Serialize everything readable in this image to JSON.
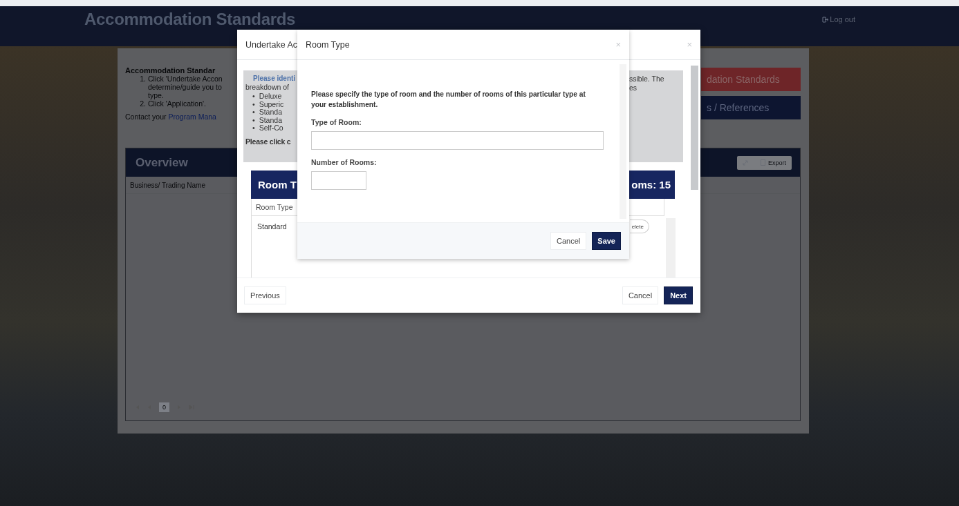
{
  "header": {
    "title": "Accommodation Standards",
    "logout": "Log out"
  },
  "page": {
    "intro_title": "Accommodation Standar",
    "steps": [
      {
        "number": "1.",
        "lines": [
          "Click 'Undertake Accon",
          "determine/guide you to",
          "type."
        ]
      },
      {
        "number": "2.",
        "lines": [
          "Click 'Application'."
        ]
      }
    ],
    "contact": {
      "text": "Contact your",
      "link": "Program Mana"
    },
    "side_buttons": [
      {
        "label": "dation Standards",
        "kind": "primary"
      },
      {
        "label": "s / References",
        "kind": "secondary"
      }
    ],
    "overview": {
      "title": "Overview",
      "export": "Export",
      "columns": [
        "Business/ Trading Name"
      ],
      "page": "0"
    }
  },
  "outer_modal": {
    "title": "Undertake Ac",
    "close": "×",
    "info": {
      "lead": "Please identi",
      "lead_right": "ssible. The",
      "line2": "breakdown of",
      "line2_right": "es",
      "bullets": [
        {
          "marker": "•",
          "text": "Deluxe"
        },
        {
          "marker": "•",
          "text": "Superic"
        },
        {
          "marker": "•",
          "text": "Standa"
        },
        {
          "marker": "•",
          "text": "Standa"
        },
        {
          "marker": "•",
          "text": "Self-Co"
        }
      ],
      "footer": "Please click c"
    },
    "room_table": {
      "title": "Room T",
      "total": "oms: 15",
      "columns": [
        "Room Type"
      ],
      "rows": [
        {
          "room_type": "Standard",
          "action": "elete"
        }
      ]
    },
    "buttons": {
      "previous": "Previous",
      "cancel": "Cancel",
      "next": "Next"
    }
  },
  "inner_modal": {
    "title": "Room Type",
    "close": "×",
    "instructions": "Please specify the type of room and the number of rooms of this particular type at your establishment.",
    "fields": [
      {
        "label": "Type of Room:",
        "kind": "wide"
      },
      {
        "label": "Number of Rooms:",
        "kind": "narrow"
      }
    ],
    "buttons": {
      "cancel": "Cancel",
      "save": "Save"
    }
  }
}
